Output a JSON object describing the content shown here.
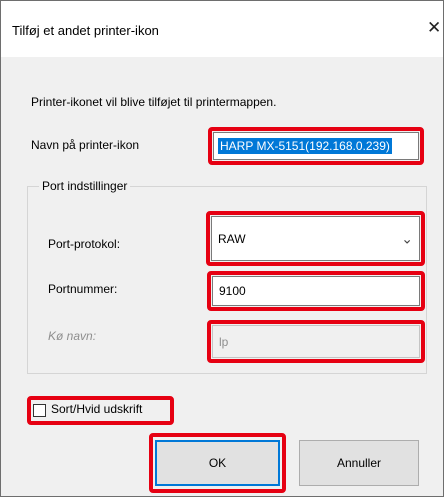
{
  "window": {
    "title": "Tilføj et andet printer-ikon",
    "close_glyph": "✕"
  },
  "intro_text": "Printer-ikonet vil blive tilføjet til printermappen.",
  "name_field": {
    "label": "Navn på printer-ikon",
    "value": "HARP MX-5151(192.168.0.239)"
  },
  "port_group": {
    "title": "Port indstillinger",
    "protocol": {
      "label": "Port-protokol:",
      "value": "RAW",
      "chevron": "⌄"
    },
    "port_number": {
      "label": "Portnummer:",
      "value": "9100"
    },
    "queue_name": {
      "label": "Kø navn:",
      "value": "lp"
    }
  },
  "mono_checkbox": {
    "label": "Sort/Hvid udskrift",
    "checked": false
  },
  "buttons": {
    "ok": "OK",
    "cancel": "Annuller"
  },
  "colors": {
    "highlight": "#e60012",
    "selection": "#0078d7",
    "dialog_bg": "#f0f0f0"
  }
}
